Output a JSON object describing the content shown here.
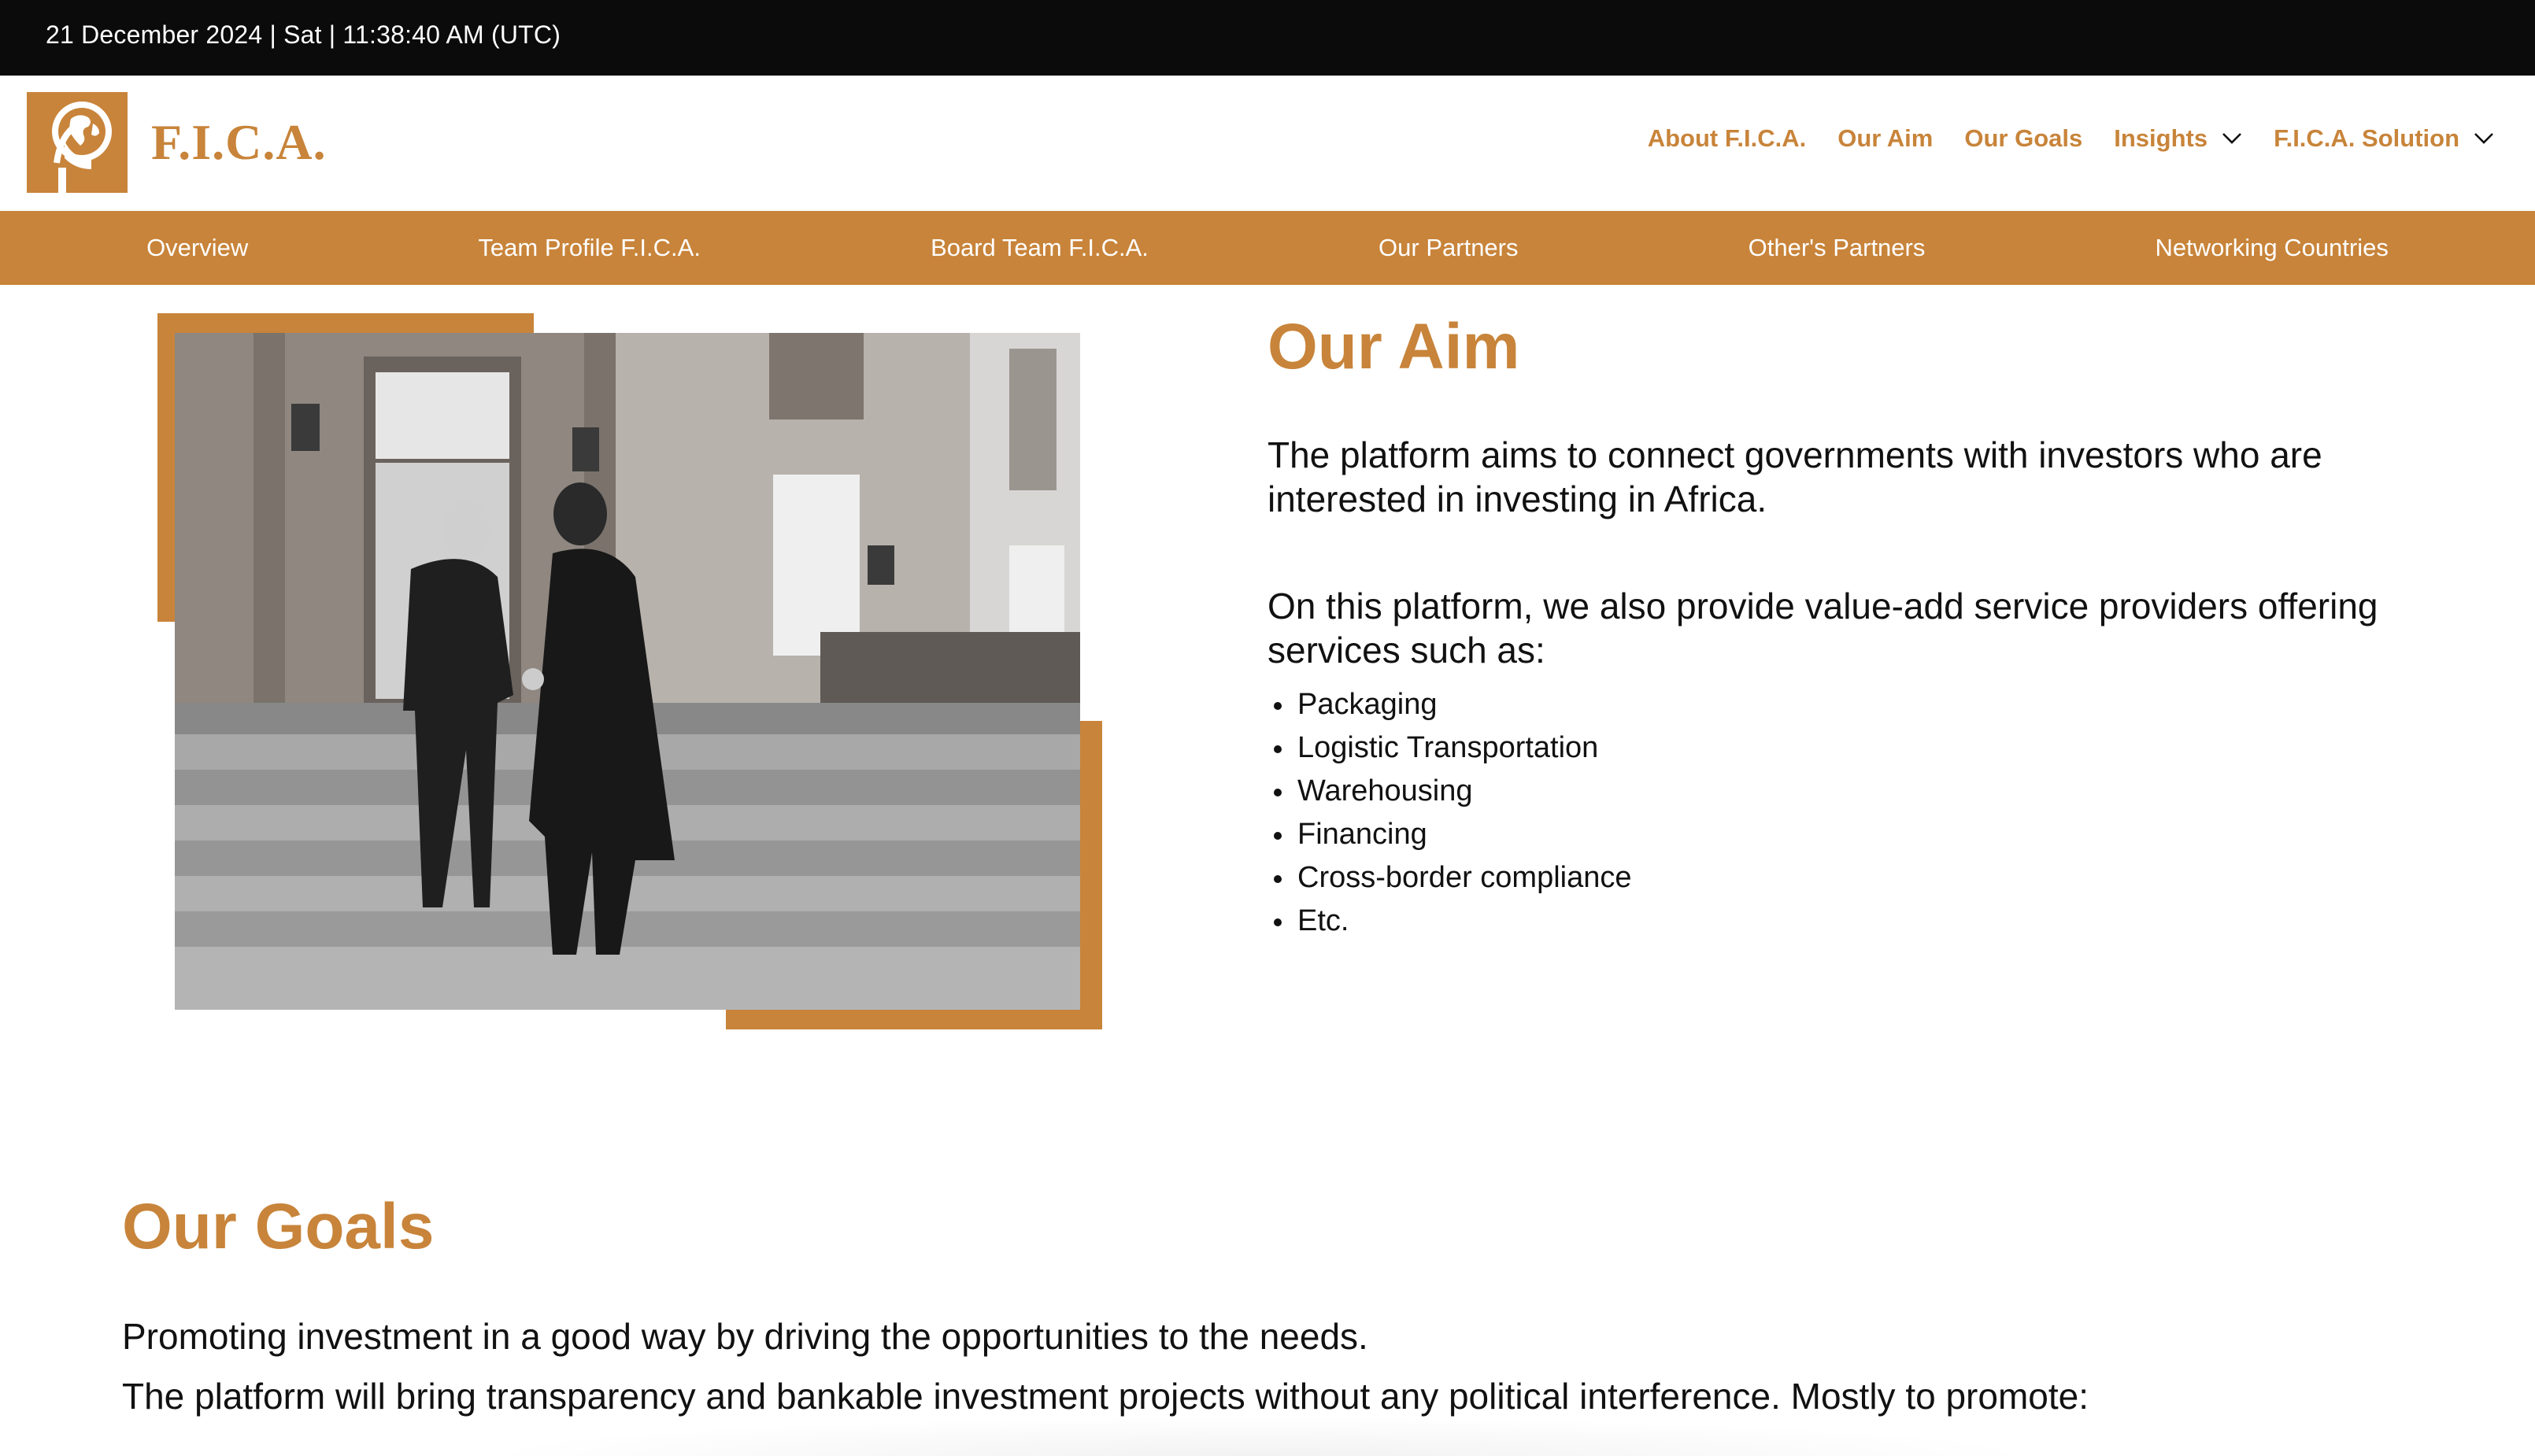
{
  "topbar": {
    "datetime": "21 December 2024 | Sat | 11:38:40 AM (UTC)"
  },
  "header": {
    "logo_text": "F.I.C.A.",
    "nav": [
      {
        "label": "About F.I.C.A.",
        "icon": ""
      },
      {
        "label": "Our Aim",
        "icon": ""
      },
      {
        "label": "Our Goals",
        "icon": ""
      },
      {
        "label": "Insights",
        "icon": "chevron-down-icon"
      },
      {
        "label": "F.I.C.A. Solution",
        "icon": "chevron-down-icon"
      }
    ]
  },
  "subnav": [
    "Overview",
    "Team Profile F.I.C.A.",
    "Board Team F.I.C.A.",
    "Our Partners",
    "Other's Partners",
    "Networking Countries"
  ],
  "aim": {
    "title": "Our Aim",
    "paragraph1": "The platform aims to connect governments with investors who are interested in investing in Africa.",
    "paragraph2": "On this platform, we also provide value-add service providers offering services such as:",
    "services": [
      "Packaging",
      "Logistic Transportation",
      "Warehousing",
      "Financing",
      "Cross-border compliance",
      "Etc."
    ]
  },
  "goals": {
    "title": "Our Goals",
    "line1": "Promoting investment in a good way by driving the opportunities to the needs.",
    "line2": "The platform will bring transparency and bankable investment projects without any political interference. Mostly to promote:"
  },
  "colors": {
    "accent": "#c8843a",
    "topbar": "#0b0b0b",
    "text": "#111111"
  }
}
